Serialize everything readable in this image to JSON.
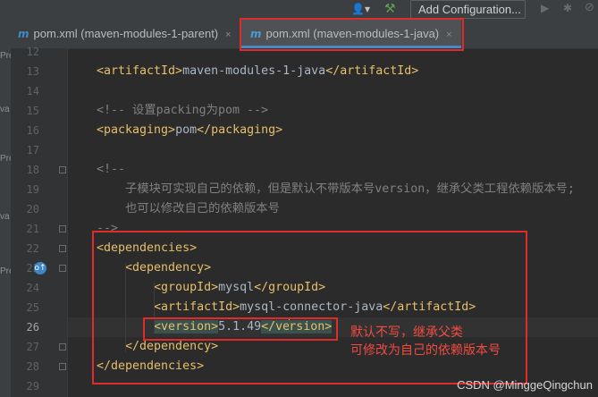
{
  "toolbar": {
    "add_configuration": "Add Configuration...",
    "icons": [
      "user-icon",
      "hammer-icon",
      "run-icon",
      "debug-icon",
      "more-icon"
    ]
  },
  "tabs": [
    {
      "icon": "m",
      "label": "pom.xml (maven-modules-1-parent)",
      "close": "×"
    },
    {
      "icon": "m",
      "label": "pom.xml (maven-modules-1-java)",
      "close": "×"
    }
  ],
  "side_labels": [
    "Pre",
    "va",
    "Pre",
    "va",
    "Pre"
  ],
  "lines": [
    {
      "n": "12",
      "parts": []
    },
    {
      "n": "13",
      "parts": [
        [
          "tag",
          "<artifactId>"
        ],
        [
          "txt",
          "maven-modules-1-java"
        ],
        [
          "tag",
          "</artifactId>"
        ]
      ]
    },
    {
      "n": "14",
      "parts": []
    },
    {
      "n": "15",
      "parts": [
        [
          "cmt",
          "<!-- 设置packing为pom -->"
        ]
      ]
    },
    {
      "n": "16",
      "parts": [
        [
          "tag",
          "<packaging>"
        ],
        [
          "txt",
          "pom"
        ],
        [
          "tag",
          "</packaging>"
        ]
      ]
    },
    {
      "n": "17",
      "parts": []
    },
    {
      "n": "18",
      "parts": [
        [
          "cmt",
          "<!--"
        ]
      ]
    },
    {
      "n": "19",
      "parts": [
        [
          "cmt",
          "    子模块可实现自己的依赖，但是默认不带版本号version，继承父类工程依赖版本号;"
        ]
      ]
    },
    {
      "n": "20",
      "parts": [
        [
          "cmt",
          "    也可以修改自己的依赖版本号"
        ]
      ]
    },
    {
      "n": "21",
      "parts": [
        [
          "cmt",
          "-->"
        ]
      ]
    },
    {
      "n": "22",
      "parts": [
        [
          "tag",
          "<dependencies>"
        ]
      ]
    },
    {
      "n": "23",
      "parts": [
        [
          "tag",
          "    <dependency>"
        ]
      ]
    },
    {
      "n": "24",
      "parts": [
        [
          "tag",
          "        <groupId>"
        ],
        [
          "txt",
          "mysql"
        ],
        [
          "tag",
          "</groupId>"
        ]
      ]
    },
    {
      "n": "25",
      "parts": [
        [
          "tag",
          "        <artifactId>"
        ],
        [
          "txt",
          "mysql-connector-java"
        ],
        [
          "tag",
          "</artifactId>"
        ]
      ]
    },
    {
      "n": "26",
      "parts": [
        [
          "tag",
          "        <version>"
        ],
        [
          "txt",
          "5.1.49"
        ],
        [
          "tag",
          "</ve"
        ],
        [
          "caret",
          ""
        ],
        [
          "tag",
          "rsion>"
        ]
      ]
    },
    {
      "n": "27",
      "parts": [
        [
          "tag",
          "    </dependency>"
        ]
      ]
    },
    {
      "n": "28",
      "parts": [
        [
          "tag",
          "</dependencies>"
        ]
      ]
    },
    {
      "n": "29",
      "parts": []
    }
  ],
  "annotation": {
    "line1": "默认不写，继承父类",
    "line2": "可修改为自己的依赖版本号"
  },
  "watermark": "CSDN @MinggeQingchun",
  "colors": {
    "accent": "#4a88c7",
    "highlight_box": "#e02b2b",
    "tag": "#e8bf6a",
    "comment": "#808080"
  }
}
